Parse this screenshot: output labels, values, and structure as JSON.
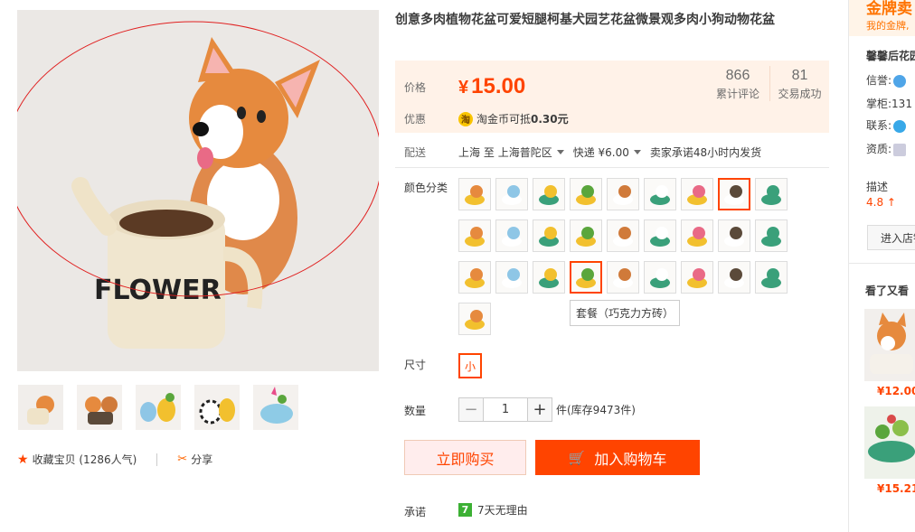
{
  "product": {
    "title": "创意多肉植物花盆可爱短腿柯基犬园艺花盆微景观多肉小狗动物花盆",
    "image_text": "FLOWER"
  },
  "price": {
    "label": "价格",
    "currency": "¥",
    "value": "15.00",
    "reviews_count": "866",
    "reviews_label": "累计评论",
    "sales_count": "81",
    "sales_label": "交易成功"
  },
  "promo": {
    "label": "优惠",
    "coin_icon": "coin-icon",
    "text_prefix": "淘金币可抵",
    "text_amount": "0.30元"
  },
  "delivery": {
    "label": "配送",
    "from": "上海",
    "to_word": "至",
    "to": "上海普陀区",
    "shipping": "快递 ¥6.00",
    "promise": "卖家承诺48小时内发货"
  },
  "color": {
    "label": "颜色分类",
    "swatch_count": 28,
    "selected_row1": 7,
    "selected_row3": 3,
    "tooltip": "套餐（巧克力方砖）"
  },
  "size": {
    "label": "尺寸",
    "option": "小"
  },
  "quantity": {
    "label": "数量",
    "minus": "−",
    "value": "1",
    "plus": "+",
    "stock": "件(库存9473件)"
  },
  "buttons": {
    "buy_now": "立即购买",
    "add_cart": "加入购物车"
  },
  "guarantee": {
    "label": "承诺",
    "badge": "7",
    "text": "7天无理由"
  },
  "actions": {
    "favorite": "收藏宝贝 (1286人气)",
    "share": "分享"
  },
  "shop": {
    "gold_title": "金牌卖",
    "gold_sub": "我的金牌,",
    "name": "馨馨后花园",
    "credit_label": "信誉:",
    "keeper_label": "掌柜:",
    "keeper_value": "131",
    "contact_label": "联系:",
    "qual_label": "资质:",
    "desc_label": "描述",
    "desc_score": "4.8 ↑",
    "enter_label": "进入店铺"
  },
  "recommend": {
    "title": "看了又看",
    "items": [
      {
        "price": "¥12.00"
      },
      {
        "price": "¥15.21"
      }
    ]
  },
  "colors": {
    "accent": "#ff4400",
    "price_bg": "#fff2e8",
    "gold": "#ff7300"
  }
}
